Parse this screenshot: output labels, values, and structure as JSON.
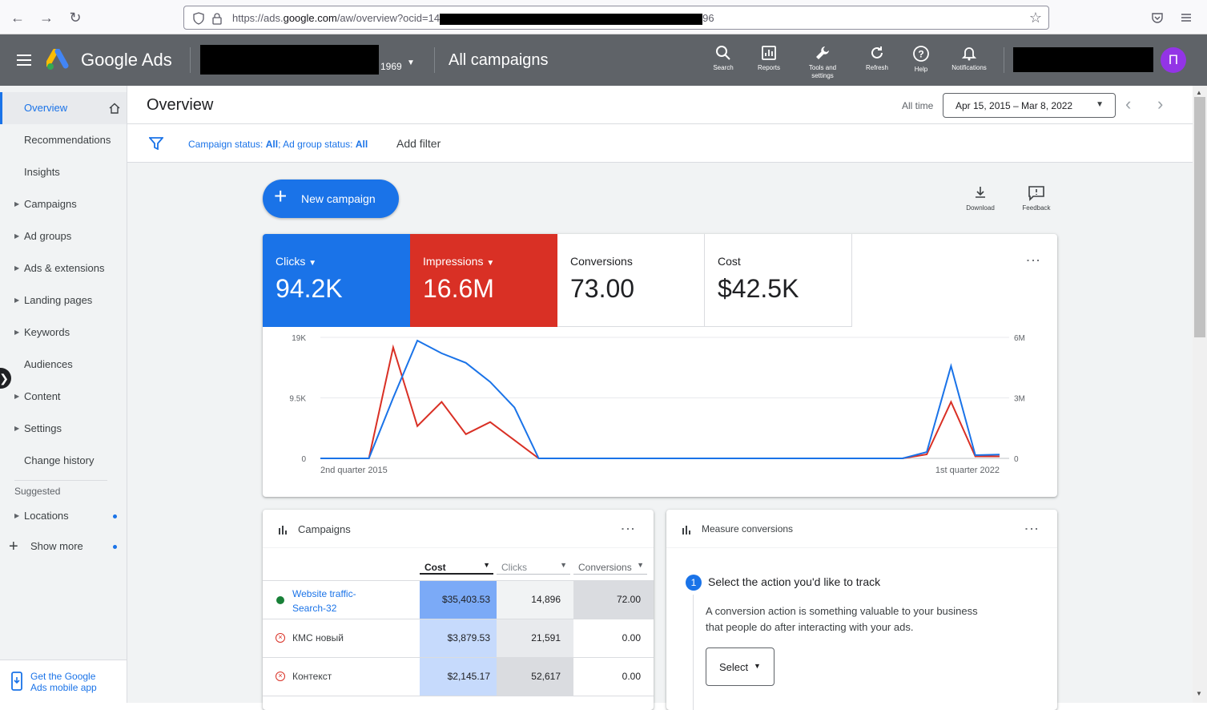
{
  "browser": {
    "url_prefix": "https://ads.",
    "url_domain": "google.com",
    "url_path": "/aw/overview?ocid=14",
    "url_suffix": "96"
  },
  "header": {
    "menu_icon": "menu-icon",
    "brand": "Google Ads",
    "account_suffix": "1969",
    "scope_title": "All campaigns",
    "tools": [
      {
        "label": "Search",
        "icon": "search-icon"
      },
      {
        "label": "Reports",
        "icon": "reports-icon"
      },
      {
        "label": "Tools and settings",
        "icon": "wrench-icon"
      },
      {
        "label": "Refresh",
        "icon": "refresh-icon"
      },
      {
        "label": "Help",
        "icon": "help-icon"
      },
      {
        "label": "Notifications",
        "icon": "bell-icon"
      }
    ],
    "avatar_letter": "П",
    "avatar_color": "#9334e6"
  },
  "sidebar": {
    "items": [
      {
        "label": "Overview",
        "active": true
      },
      {
        "label": "Recommendations"
      },
      {
        "label": "Insights"
      },
      {
        "label": "Campaigns",
        "expandable": true
      },
      {
        "label": "Ad groups",
        "expandable": true
      },
      {
        "label": "Ads & extensions",
        "expandable": true
      },
      {
        "label": "Landing pages",
        "expandable": true
      },
      {
        "label": "Keywords",
        "expandable": true
      },
      {
        "label": "Audiences"
      },
      {
        "label": "Content",
        "expandable": true
      },
      {
        "label": "Settings",
        "expandable": true
      },
      {
        "label": "Change history"
      }
    ],
    "suggested_heading": "Suggested",
    "suggested_items": [
      {
        "label": "Locations",
        "expandable": true
      },
      {
        "label": "Show more"
      }
    ],
    "mobile_app_line1": "Get the Google",
    "mobile_app_line2": "Ads mobile app"
  },
  "overview": {
    "title": "Overview",
    "date_range_label": "All time",
    "date_range": "Apr 15, 2015 – Mar 8, 2022"
  },
  "filters": {
    "campaign_status_label": "Campaign status: ",
    "campaign_status_value": "All",
    "separator": "; ",
    "ad_group_status_label": "Ad group status: ",
    "ad_group_status_value": "All",
    "add_filter": "Add filter"
  },
  "actions": {
    "new_campaign": "New campaign",
    "download": "Download",
    "feedback": "Feedback"
  },
  "metrics": [
    {
      "label": "Clicks",
      "value": "94.2K",
      "color": "#1a73e8",
      "dropdown": true
    },
    {
      "label": "Impressions",
      "value": "16.6M",
      "color": "#d93025",
      "dropdown": true
    },
    {
      "label": "Conversions",
      "value": "73.00"
    },
    {
      "label": "Cost",
      "value": "$42.5K"
    }
  ],
  "chart_data": {
    "type": "line",
    "x_start_label": "2nd quarter 2015",
    "x_end_label": "1st quarter 2022",
    "y_left_ticks": [
      "19K",
      "9.5K",
      "0"
    ],
    "y_right_ticks": [
      "6M",
      "3M",
      "0"
    ],
    "ylim_left": [
      0,
      19000
    ],
    "ylim_right": [
      0,
      6000000
    ],
    "series": [
      {
        "name": "Clicks",
        "axis": "left",
        "color": "#1a73e8",
        "values": [
          0,
          0,
          0,
          9500,
          18500,
          16500,
          15000,
          12000,
          8000,
          0,
          0,
          0,
          0,
          0,
          0,
          0,
          0,
          0,
          0,
          0,
          0,
          0,
          0,
          0,
          0,
          1000,
          14500,
          500,
          600
        ]
      },
      {
        "name": "Impressions",
        "axis": "right",
        "color": "#d93025",
        "values": [
          0,
          0,
          0,
          5500000,
          1600000,
          2800000,
          1200000,
          1800000,
          900000,
          0,
          0,
          0,
          0,
          0,
          0,
          0,
          0,
          0,
          0,
          0,
          0,
          0,
          0,
          0,
          0,
          200000,
          2800000,
          100000,
          100000
        ]
      }
    ]
  },
  "campaigns_card": {
    "title": "Campaigns",
    "columns": [
      "Cost",
      "Clicks",
      "Conversions"
    ],
    "rows": [
      {
        "name_line1": "Website traffic-",
        "name_line2": "Search-32",
        "status": "enabled",
        "cost": "$35,403.53",
        "clicks": "14,896",
        "conversions": "72.00"
      },
      {
        "name_line1": "КМС новый",
        "name_line2": "",
        "status": "removed",
        "cost": "$3,879.53",
        "clicks": "21,591",
        "conversions": "0.00"
      },
      {
        "name_line1": "Контекст",
        "name_line2": "",
        "status": "removed",
        "cost": "$2,145.17",
        "clicks": "52,617",
        "conversions": "0.00"
      }
    ]
  },
  "measure_card": {
    "title": "Measure conversions",
    "step_number": "1",
    "step_title": "Select the action you'd like to track",
    "desc_line1": "A conversion action is something valuable to your business",
    "desc_line2": "that people do after interacting with your ads.",
    "select_label": "Select"
  }
}
